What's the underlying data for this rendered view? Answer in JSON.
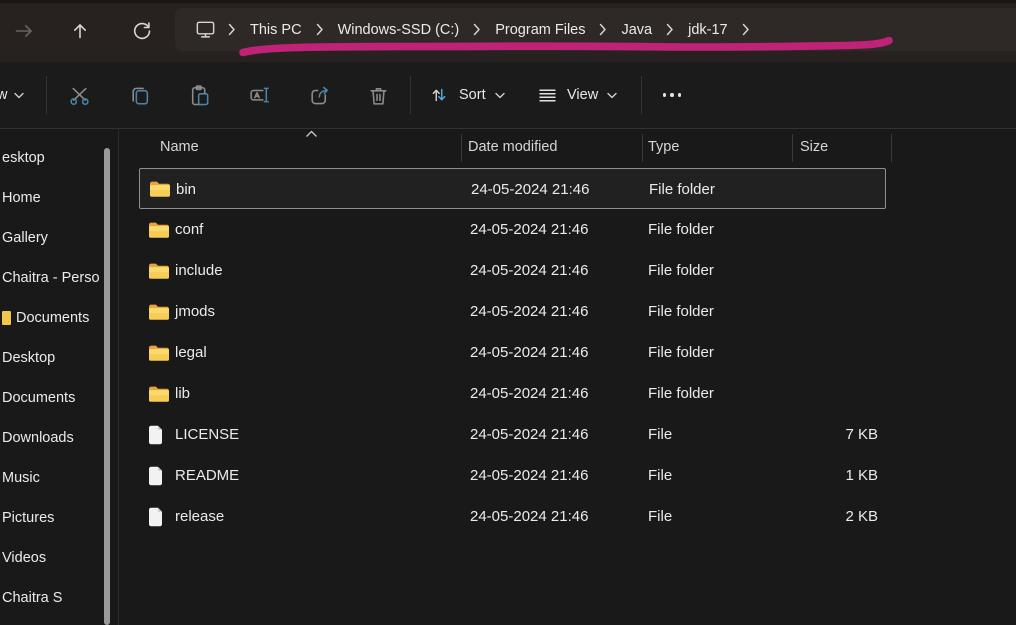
{
  "colors": {
    "accent_icon_blue": "#4d84a8",
    "sort_arrow_blue": "#57a8dd",
    "folder_yellow": "#f5c84c",
    "annotation_pink": "#c02277",
    "selection_border": "#8f8f8f"
  },
  "titlebar": {
    "nav": {
      "forward_icon": "forward-arrow",
      "up_icon": "up-arrow",
      "refresh_icon": "refresh"
    },
    "breadcrumb": {
      "device_icon": "monitor",
      "items": [
        "This PC",
        "Windows-SSD (C:)",
        "Program Files",
        "Java",
        "jdk-17"
      ],
      "trailing_chevron": true,
      "annotation": "pink-marker-underline"
    }
  },
  "toolbar": {
    "new_button_partial_label": "w",
    "buttons": [
      "cut",
      "copy",
      "paste",
      "rename",
      "share",
      "delete"
    ],
    "sort_label": "Sort",
    "view_label": "View",
    "more_icon": "ellipsis"
  },
  "sidebar": {
    "items": [
      {
        "label": "esktop"
      },
      {
        "label": "Home"
      },
      {
        "label": "Gallery"
      },
      {
        "label": "Chaitra - Perso"
      },
      {
        "label": "Documents",
        "has_folder_icon": true
      },
      {
        "label": "Desktop"
      },
      {
        "label": "Documents"
      },
      {
        "label": "Downloads"
      },
      {
        "label": "Music"
      },
      {
        "label": "Pictures"
      },
      {
        "label": "Videos"
      },
      {
        "label": "Chaitra S"
      }
    ]
  },
  "filelist": {
    "columns": [
      "Name",
      "Date modified",
      "Type",
      "Size"
    ],
    "sort": {
      "column": "Name",
      "direction": "ascending"
    },
    "rows": [
      {
        "name": "bin",
        "date": "24-05-2024 21:46",
        "type": "File folder",
        "size": "",
        "icon": "folder",
        "selected": true
      },
      {
        "name": "conf",
        "date": "24-05-2024 21:46",
        "type": "File folder",
        "size": "",
        "icon": "folder",
        "selected": false
      },
      {
        "name": "include",
        "date": "24-05-2024 21:46",
        "type": "File folder",
        "size": "",
        "icon": "folder",
        "selected": false
      },
      {
        "name": "jmods",
        "date": "24-05-2024 21:46",
        "type": "File folder",
        "size": "",
        "icon": "folder",
        "selected": false
      },
      {
        "name": "legal",
        "date": "24-05-2024 21:46",
        "type": "File folder",
        "size": "",
        "icon": "folder",
        "selected": false
      },
      {
        "name": "lib",
        "date": "24-05-2024 21:46",
        "type": "File folder",
        "size": "",
        "icon": "folder",
        "selected": false
      },
      {
        "name": "LICENSE",
        "date": "24-05-2024 21:46",
        "type": "File",
        "size": "7 KB",
        "icon": "file",
        "selected": false
      },
      {
        "name": "README",
        "date": "24-05-2024 21:46",
        "type": "File",
        "size": "1 KB",
        "icon": "file",
        "selected": false
      },
      {
        "name": "release",
        "date": "24-05-2024 21:46",
        "type": "File",
        "size": "2 KB",
        "icon": "file",
        "selected": false
      }
    ]
  }
}
